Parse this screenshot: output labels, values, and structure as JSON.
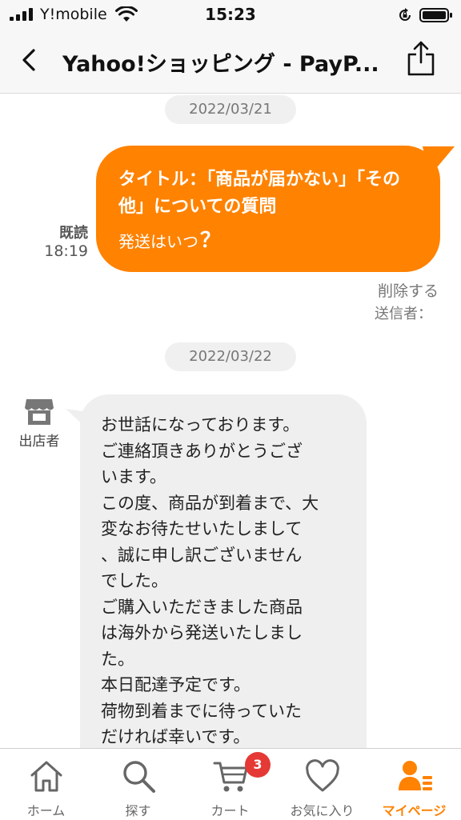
{
  "status_bar": {
    "carrier": "Y!mobile",
    "time": "15:23"
  },
  "nav": {
    "title": "Yahoo!ショッピング - PayP..."
  },
  "messages": {
    "date1": "2022/03/21",
    "sent": {
      "title": "タイトル：「商品が届かない」「その他」についての質問",
      "body": "発送はいつ",
      "question_mark": "？",
      "read_label": "既読",
      "time": "18:19",
      "delete_label": "削除する",
      "sender_label": "送信者："
    },
    "date2": "2022/03/22",
    "received": {
      "store_label": "出店者",
      "body": "お世話になっております。\nご連絡頂きありがとうござ\nいます。\nこの度、商品が到着まで、大\n変なお待たせいたしまして\n、誠に申し訳ございません\nでした。\nご購入いただきました商品\nは海外から発送いたしまし\nた。\n本日配達予定です。\n荷物到着までに待っていた\nだければ幸いです。"
    }
  },
  "tab_bar": {
    "home": "ホーム",
    "search": "探す",
    "cart": "カート",
    "cart_badge": "3",
    "favorites": "お気に入り",
    "mypage": "マイページ",
    "active_tab": "mypage"
  },
  "colors": {
    "accent": "#ff8200",
    "badge": "#e53935",
    "received_bubble": "#efefef"
  },
  "icons": [
    "signal-icon",
    "wifi-icon",
    "rotation-lock-icon",
    "battery-icon",
    "back-chevron-icon",
    "share-icon",
    "store-icon",
    "home-icon",
    "search-icon",
    "cart-icon",
    "heart-icon",
    "mypage-icon"
  ]
}
